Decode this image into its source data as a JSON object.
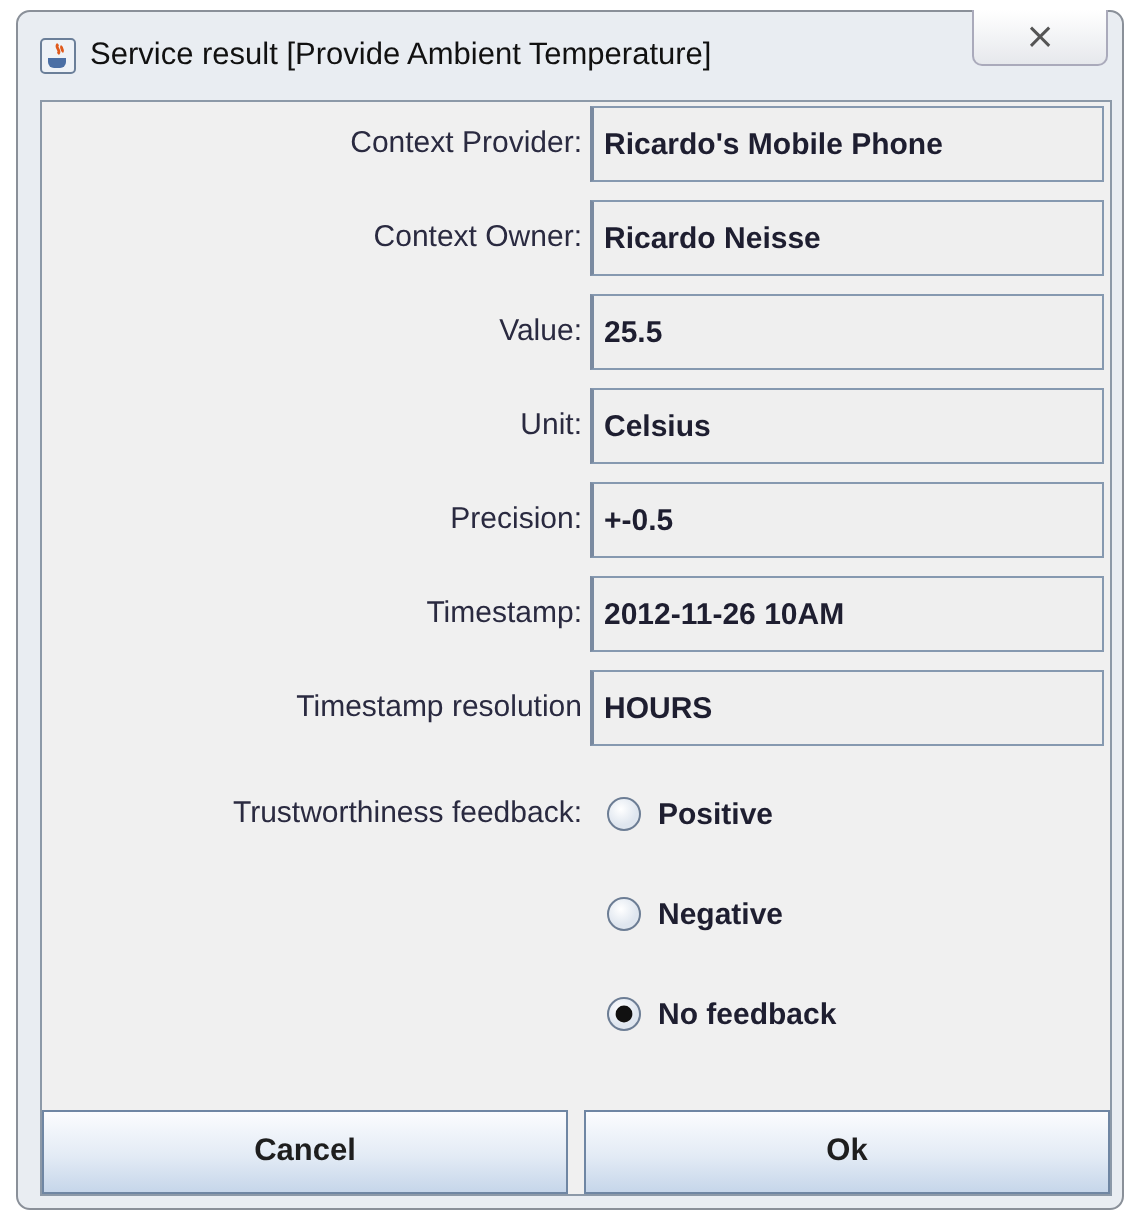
{
  "window": {
    "title": "Service result [Provide Ambient Temperature]",
    "close": "⨯"
  },
  "fields": [
    {
      "label": "Context Provider:",
      "value": "Ricardo's Mobile Phone"
    },
    {
      "label": "Context Owner:",
      "value": "Ricardo Neisse"
    },
    {
      "label": "Value:",
      "value": "25.5"
    },
    {
      "label": "Unit:",
      "value": "Celsius"
    },
    {
      "label": "Precision:",
      "value": "+-0.5"
    },
    {
      "label": "Timestamp:",
      "value": "2012-11-26 10AM"
    },
    {
      "label": "Timestamp resolution",
      "value": "HOURS"
    }
  ],
  "feedback": {
    "label": "Trustworthiness feedback:",
    "options": [
      {
        "label": "Positive",
        "selected": false
      },
      {
        "label": "Negative",
        "selected": false
      },
      {
        "label": "No feedback",
        "selected": true
      }
    ]
  },
  "buttons": [
    "Cancel",
    "Ok"
  ]
}
